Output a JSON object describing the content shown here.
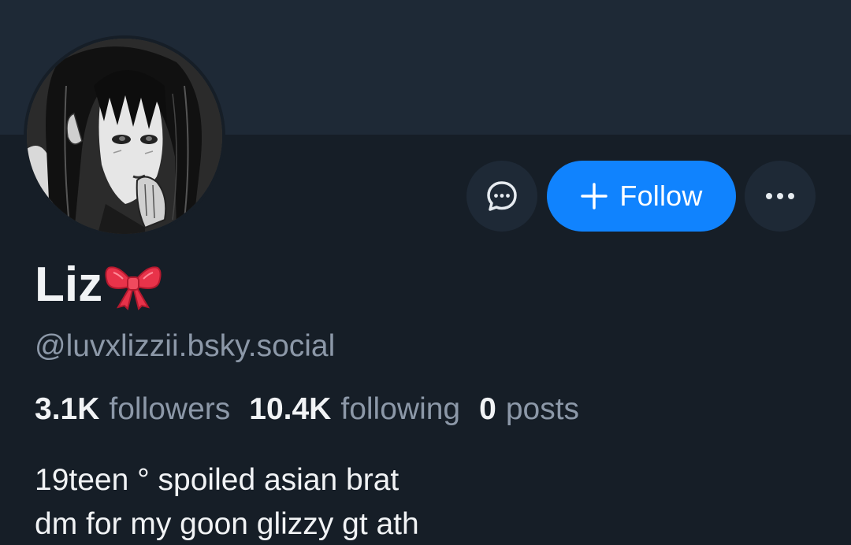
{
  "profile": {
    "display_name": "Liz",
    "name_emoji": "ribbon-emoji",
    "handle": "@luvxlizzii.bsky.social",
    "avatar_icon": "anime-girl-avatar"
  },
  "actions": {
    "message_icon": "chat-bubble-icon",
    "follow_label": "Follow",
    "follow_icon": "plus-icon",
    "more_icon": "ellipsis-icon"
  },
  "stats": {
    "followers_count": "3.1K",
    "followers_label": "followers",
    "following_count": "10.4K",
    "following_label": "following",
    "posts_count": "0",
    "posts_label": "posts"
  },
  "bio": {
    "line1": "19teen ° spoiled asian brat",
    "line2": "dm for my goon glizzy gt ath"
  },
  "colors": {
    "background": "#161e27",
    "banner": "#1e2936",
    "accent": "#1083fe",
    "muted_text": "#8c98a8",
    "primary_text": "#f1f3f5"
  }
}
